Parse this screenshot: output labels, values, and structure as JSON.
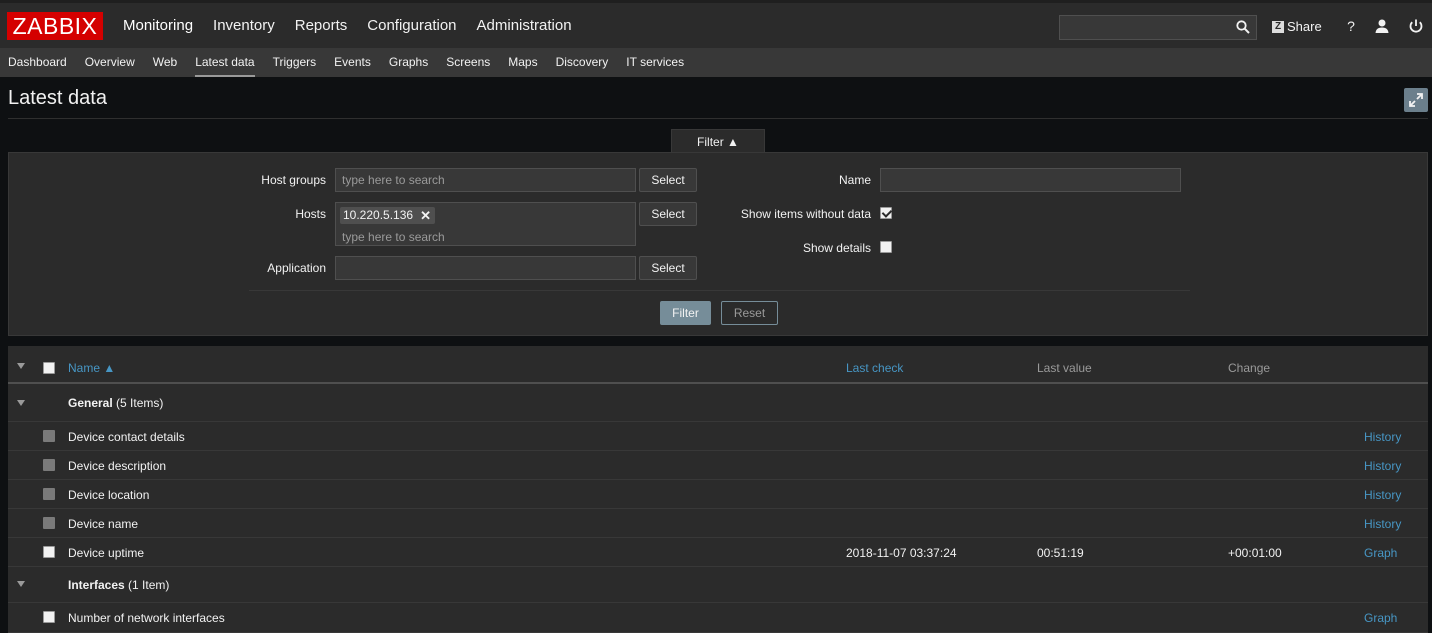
{
  "brand": {
    "logo": "ZABBIX",
    "color": "#d40000"
  },
  "top_menu": [
    "Monitoring",
    "Inventory",
    "Reports",
    "Configuration",
    "Administration"
  ],
  "top_menu_active": "Monitoring",
  "header_actions": {
    "share_label": "Share",
    "help_label": "?"
  },
  "sub_menu": [
    "Dashboard",
    "Overview",
    "Web",
    "Latest data",
    "Triggers",
    "Events",
    "Graphs",
    "Screens",
    "Maps",
    "Discovery",
    "IT services"
  ],
  "sub_menu_active": "Latest data",
  "page_title": "Latest data",
  "filter": {
    "tab_label": "Filter ▲",
    "host_groups_label": "Host groups",
    "host_groups_placeholder": "type here to search",
    "hosts_label": "Hosts",
    "hosts_selected": "10.220.5.136",
    "hosts_placeholder": "type here to search",
    "application_label": "Application",
    "application_value": "",
    "select_label": "Select",
    "name_label": "Name",
    "name_value": "",
    "show_items_without_data_label": "Show items without data",
    "show_items_without_data": true,
    "show_details_label": "Show details",
    "show_details": false,
    "filter_button": "Filter",
    "reset_button": "Reset"
  },
  "table": {
    "headers": {
      "name": "Name ▲",
      "last_check": "Last check",
      "last_value": "Last value",
      "change": "Change"
    },
    "rows": [
      {
        "type": "group",
        "name": "General",
        "count": " (5 Items)"
      },
      {
        "type": "item",
        "name": "Device contact details",
        "last_check": "",
        "last_value": "",
        "change": "",
        "action": "History",
        "checkbox_disabled": true
      },
      {
        "type": "item",
        "name": "Device description",
        "last_check": "",
        "last_value": "",
        "change": "",
        "action": "History",
        "checkbox_disabled": true
      },
      {
        "type": "item",
        "name": "Device location",
        "last_check": "",
        "last_value": "",
        "change": "",
        "action": "History",
        "checkbox_disabled": true
      },
      {
        "type": "item",
        "name": "Device name",
        "last_check": "",
        "last_value": "",
        "change": "",
        "action": "History",
        "checkbox_disabled": true
      },
      {
        "type": "item",
        "name": "Device uptime",
        "last_check": "2018-11-07 03:37:24",
        "last_value": "00:51:19",
        "change": "+00:01:00",
        "action": "Graph",
        "checkbox_disabled": false
      },
      {
        "type": "group",
        "name": "Interfaces",
        "count": " (1 Item)"
      },
      {
        "type": "item",
        "name": "Number of network interfaces",
        "last_check": "",
        "last_value": "",
        "change": "",
        "action": "Graph",
        "checkbox_disabled": false
      }
    ]
  }
}
